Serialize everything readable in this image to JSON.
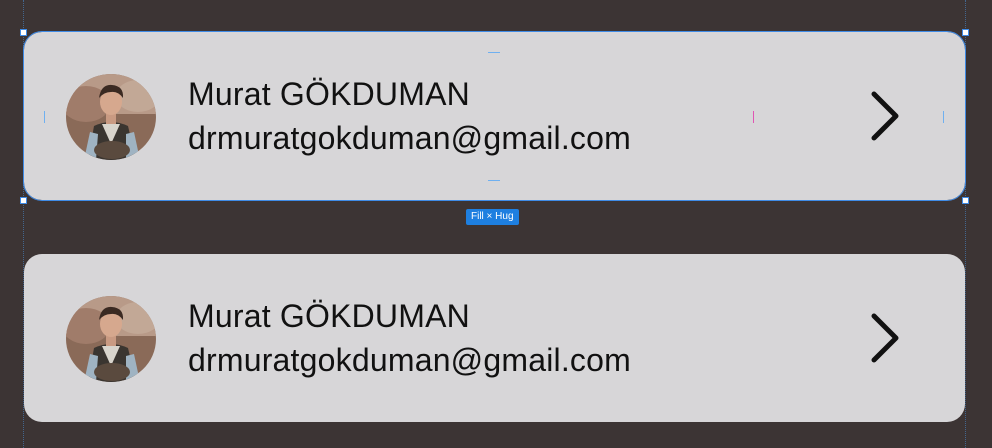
{
  "cards": [
    {
      "name": "Murat GÖKDUMAN",
      "email": "drmuratgokduman@gmail.com",
      "avatar_icon": "profile-photo",
      "action_icon": "chevron-right-icon",
      "selected": true
    },
    {
      "name": "Murat GÖKDUMAN",
      "email": "drmuratgokduman@gmail.com",
      "avatar_icon": "profile-photo",
      "action_icon": "chevron-right-icon",
      "selected": false
    }
  ],
  "selection": {
    "size_label": "Fill × Hug",
    "accent_color": "#3f8be6"
  },
  "colors": {
    "canvas_bg": "#3c3434",
    "card_bg": "#d7d6d8",
    "text": "#111111"
  }
}
